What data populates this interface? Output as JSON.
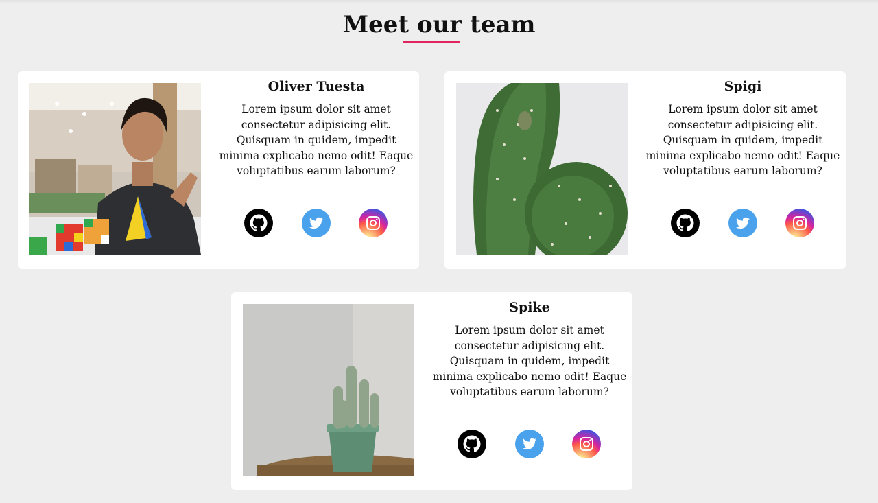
{
  "header": {
    "title": "Meet our team",
    "underline_color": "#e0245e"
  },
  "team": [
    {
      "name": "Oliver Tuesta",
      "description": "Lorem ipsum dolor sit amet consectetur adipisicing elit. Quisquam in quidem, impedit minima explicabo nemo odit! Eaque voluptatibus earum laborum?",
      "photo": "person-with-rubiks-cubes-photo",
      "socials": [
        "github-icon",
        "twitter-icon",
        "instagram-icon"
      ]
    },
    {
      "name": "Spigi",
      "description": "Lorem ipsum dolor sit amet consectetur adipisicing elit. Quisquam in quidem, impedit minima explicabo nemo odit! Eaque voluptatibus earum laborum?",
      "photo": "prickly-pear-cactus-photo",
      "socials": [
        "github-icon",
        "twitter-icon",
        "instagram-icon"
      ]
    },
    {
      "name": "Spike",
      "description": "Lorem ipsum dolor sit amet consectetur adipisicing elit. Quisquam in quidem, impedit minima explicabo nemo odit! Eaque voluptatibus earum laborum?",
      "photo": "potted-cactus-photo",
      "socials": [
        "github-icon",
        "twitter-icon",
        "instagram-icon"
      ]
    }
  ],
  "colors": {
    "background": "#eeeeee",
    "card": "#ffffff",
    "github": "#000000",
    "twitter": "#4aa1ec"
  }
}
